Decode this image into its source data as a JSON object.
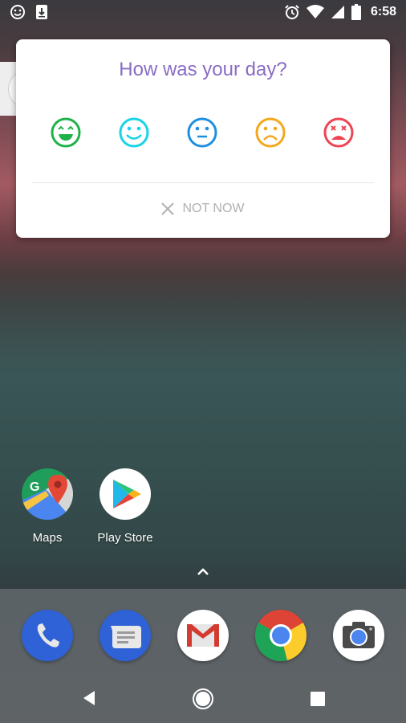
{
  "status_bar": {
    "left_icons": [
      "smiley-notification-icon",
      "download-notification-icon"
    ],
    "right_icons": [
      "alarm-icon",
      "wifi-icon",
      "signal-icon",
      "battery-icon"
    ],
    "time": "6:58"
  },
  "mood_card": {
    "title": "How was your day?",
    "title_color": "#8a6cc4",
    "moods": [
      {
        "name": "very-happy",
        "color": "#1fb24a"
      },
      {
        "name": "happy",
        "color": "#19d3e6"
      },
      {
        "name": "neutral",
        "color": "#1e8fe0"
      },
      {
        "name": "sad",
        "color": "#f3a81c"
      },
      {
        "name": "very-sad",
        "color": "#ef4452"
      }
    ],
    "dismiss_label": "NOT NOW"
  },
  "home_apps": [
    {
      "label": "Maps"
    },
    {
      "label": "Play Store"
    }
  ],
  "dock": [
    "Phone",
    "Messages",
    "Gmail",
    "Chrome",
    "Camera"
  ],
  "nav": [
    "back",
    "home",
    "recents"
  ]
}
